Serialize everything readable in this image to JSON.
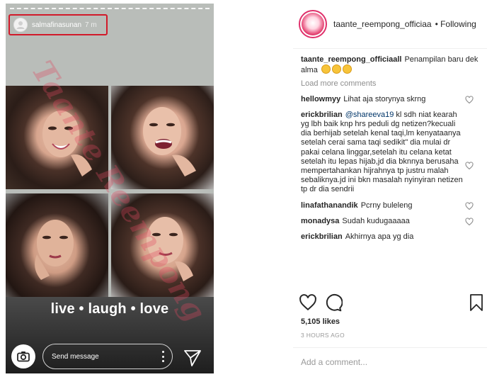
{
  "story": {
    "username": "salmafinasunan",
    "time_ago": "7 m",
    "caption": "live • laugh • love",
    "message_placeholder": "Send message",
    "watermark": "Taante Reempong"
  },
  "post": {
    "username": "taante_reempong_officiaa",
    "follow_label": "• Following",
    "caption_user": "taante_reempong_officiaall",
    "caption_text": "Penampilan baru dek alma",
    "load_more": "Load more comments",
    "comments": [
      {
        "user": "hellowmyy",
        "text": "Lihat aja storynya skrng"
      },
      {
        "user": "erickbrilian",
        "mention": "@shareeva19",
        "text": " kl sdh niat kearah yg lbh baik knp hrs peduli dg netizen?kecuali dia berhijab setelah kenal taqi,lm kenyataanya setelah cerai sama taqi sedikit\" dia mulai dr pakai celana linggar,setelah itu celana ketat setelah itu lepas hijab,jd dia bknnya berusaha mempertahankan hijrahnya tp justru malah sebaliknya.jd ini bkn masalah nyinyiran netizen tp dr dia sendrii"
      },
      {
        "user": "linafathanandik",
        "text": "Pcrny buleleng"
      },
      {
        "user": "monadysa",
        "text": "Sudah kudugaaaaa"
      },
      {
        "user": "erickbrilian",
        "text": "Akhirnya apa yg dia"
      }
    ],
    "likes": "5,105 likes",
    "time": "3 HOURS AGO",
    "add_comment_placeholder": "Add a comment..."
  },
  "colors": {
    "highlight_box": "#d11a2a",
    "link": "#003569",
    "muted": "#8e8e8e",
    "text": "#262626"
  }
}
